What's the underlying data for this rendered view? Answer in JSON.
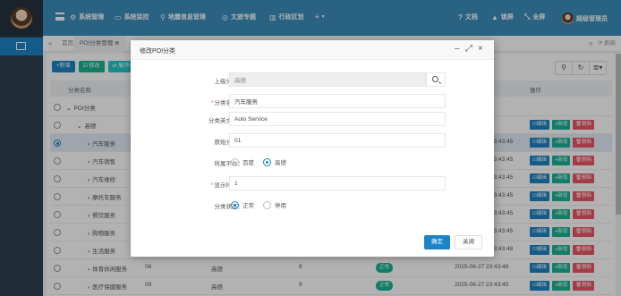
{
  "topnav": [
    {
      "icon": "gear-icon",
      "glyph": "⚙",
      "label": "系统管理"
    },
    {
      "icon": "monitor-icon",
      "glyph": "▭",
      "label": "系统监控"
    },
    {
      "icon": "map-pin-icon",
      "glyph": "⚲",
      "label": "地震信息管理"
    },
    {
      "icon": "topic-icon",
      "glyph": "◎",
      "label": "文旅专题"
    },
    {
      "icon": "building-icon",
      "glyph": "▥",
      "label": "行政区划"
    },
    {
      "icon": "more-menu-icon",
      "glyph": "≡",
      "label": ""
    }
  ],
  "topright": [
    {
      "icon": "question-icon",
      "glyph": "❓",
      "label": "文档"
    },
    {
      "icon": "lock-icon",
      "glyph": "🔒",
      "label": "锁屏"
    },
    {
      "icon": "fullscreen-icon",
      "glyph": "✥",
      "label": "全屏"
    },
    {
      "icon": "user-avatar",
      "glyph": "",
      "label": "超级管理员"
    }
  ],
  "tabs": {
    "back": "«",
    "home": "首页",
    "current": "POI分类管理 ⊗",
    "forward": "»",
    "refresh": "⟳ 刷新"
  },
  "toolbar": {
    "add": "+新增",
    "edit": "☑ 修改",
    "expand": "⇄ 展开/"
  },
  "table": {
    "headers": {
      "name": "分类名称",
      "op": "操作"
    },
    "rows": [
      {
        "indent": 1,
        "arrow": "⌄",
        "name": "POI分类",
        "code": "",
        "platform": "",
        "sort": "",
        "status": "",
        "time": "",
        "ops": false,
        "selected": false
      },
      {
        "indent": 2,
        "arrow": "⌄",
        "name": "高德",
        "code": "",
        "platform": "",
        "sort": "",
        "status": "",
        "time": "",
        "ops": true,
        "selected": false
      },
      {
        "indent": 3,
        "arrow": "›",
        "name": "汽车服务",
        "code": "",
        "platform": "",
        "sort": "",
        "status": "",
        "time": "23:43:45",
        "ops": true,
        "selected": true
      },
      {
        "indent": 3,
        "arrow": "›",
        "name": "汽车销售",
        "code": "",
        "platform": "",
        "sort": "",
        "status": "",
        "time": "23:43:45",
        "ops": true,
        "selected": false
      },
      {
        "indent": 3,
        "arrow": "›",
        "name": "汽车维修",
        "code": "",
        "platform": "",
        "sort": "",
        "status": "",
        "time": "23:43:45",
        "ops": true,
        "selected": false
      },
      {
        "indent": 3,
        "arrow": "›",
        "name": "摩托车服务",
        "code": "",
        "platform": "",
        "sort": "",
        "status": "",
        "time": "23:43:45",
        "ops": true,
        "selected": false
      },
      {
        "indent": 3,
        "arrow": "›",
        "name": "餐饮服务",
        "code": "",
        "platform": "",
        "sort": "",
        "status": "",
        "time": "23:43:45",
        "ops": true,
        "selected": false
      },
      {
        "indent": 3,
        "arrow": "›",
        "name": "购物服务",
        "code": "",
        "platform": "",
        "sort": "",
        "status": "",
        "time": "23:43:45",
        "ops": true,
        "selected": false
      },
      {
        "indent": 3,
        "arrow": "›",
        "name": "生活服务",
        "code": "",
        "platform": "",
        "sort": "",
        "status": "",
        "time": "23:43:48",
        "ops": true,
        "selected": false
      },
      {
        "indent": 3,
        "arrow": "›",
        "name": "体育休闲服务",
        "code": "08",
        "platform": "高德",
        "sort": "8",
        "status": "正常",
        "time": "2025-06-27 23:43:46",
        "ops": true,
        "selected": false
      },
      {
        "indent": 3,
        "arrow": "›",
        "name": "医疗保健服务",
        "code": "09",
        "platform": "高德",
        "sort": "9",
        "status": "正常",
        "time": "2025-06-27 23:43:45",
        "ops": true,
        "selected": false
      }
    ],
    "op_labels": {
      "edit": "☑编辑",
      "add": "+新增",
      "del": "🗑删除"
    }
  },
  "modal": {
    "title": "修改POI分类",
    "controls": {
      "minimize": "–",
      "maximize": "⤢",
      "close": "×"
    },
    "fields": {
      "parent": {
        "label": "上级分类：",
        "value": "高德"
      },
      "name": {
        "label": "分类名称：",
        "value": "汽车服务"
      },
      "english": {
        "label": "分类英文名：",
        "value": "Auto Service"
      },
      "code": {
        "label": "原始分类：",
        "value": "01"
      },
      "platform": {
        "label": "所属平台：",
        "options": [
          "百度",
          "高德"
        ],
        "selected": "高德"
      },
      "sort": {
        "label": "显示排序：",
        "value": "1"
      },
      "status": {
        "label": "分类状态：",
        "options": [
          "正常",
          "停用"
        ],
        "selected": "正常"
      }
    },
    "buttons": {
      "confirm": "确定",
      "close": "关闭"
    }
  },
  "colors": {
    "primary": "#1c84c6",
    "success": "#1ab394",
    "danger": "#ed5565",
    "header": "#3c8dbc",
    "sidebar": "#2f4050"
  }
}
